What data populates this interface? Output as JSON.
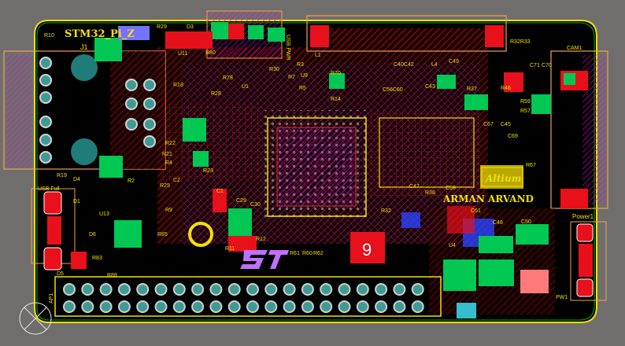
{
  "board": {
    "title": "STM32_Pi_Z",
    "author": "ARMAN ARVAND",
    "logo_text": "Altium",
    "page_number": "9",
    "colors": {
      "background": "#706e6c",
      "board": "#000000",
      "outline": "#f5e000",
      "top_copper": "#e8101a",
      "bottom_copper": "#2b44ff",
      "silkscreen": "#f5e000",
      "pads": "#00c853",
      "vias": "#8e8e8e",
      "keepout": "#ff00ff",
      "mech_outline": "#f2a050"
    }
  },
  "labels": {
    "r10": "R10",
    "r29": "R29",
    "d3": "D3",
    "usb_pwr": "USB PWR",
    "l1_small": "L1",
    "r32r33": "R32R33",
    "cam": "CAM1",
    "j1": "J1",
    "r80": "R80",
    "u11": "U11",
    "r78": "R78",
    "r18": "R18",
    "r30": "R30",
    "r7": "R7",
    "r3": "R3",
    "u9": "U9",
    "r70": "R70",
    "r5": "R5",
    "c40c42": "C40C42",
    "l4": "L4",
    "c49": "C49",
    "c71": "C71",
    "c70": "C70",
    "c56c60": "C56C60",
    "c43": "C43",
    "r14": "R14",
    "r37": "R37",
    "r46": "R46",
    "r59": "R59",
    "r22": "R22",
    "r57": "R57",
    "c67": "C67",
    "c45": "C45",
    "c69": "C69",
    "r67": "R67",
    "c47": "C47",
    "r38": "R38",
    "c59": "C59",
    "r21": "R21",
    "r23": "R23",
    "r4": "R4",
    "c61": "C61",
    "u13": "U13",
    "r9": "R9",
    "r32": "R32",
    "c50": "C50",
    "c48": "C48",
    "d6": "D6",
    "r85": "R85",
    "r11": "R11",
    "r12": "R12",
    "r61": "R61",
    "r60": "R60",
    "r62": "R62",
    "u4": "U4",
    "r83": "R83",
    "r88": "R88",
    "d5": "D5",
    "usb_full": "USB Full",
    "d4": "D4",
    "r19": "R19",
    "d1": "D1",
    "power1": "Power1",
    "pw1": "PW1",
    "ap1": "AP1",
    "r2": "R2",
    "c2": "C2",
    "r25": "R25",
    "r28": "R28",
    "u1": "U1",
    "c30": "C30",
    "c29": "C29",
    "c1": "C1"
  }
}
